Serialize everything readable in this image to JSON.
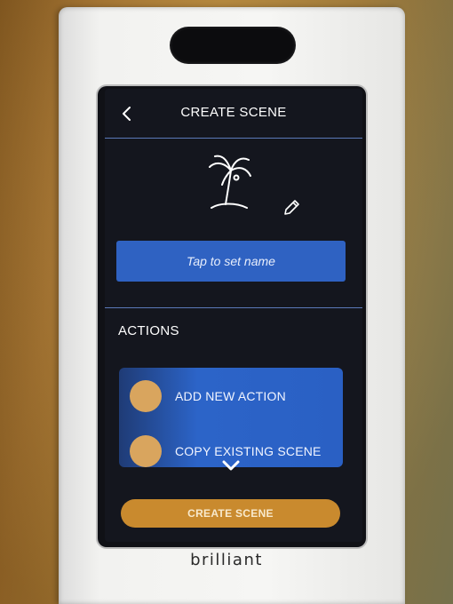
{
  "header": {
    "title": "CREATE SCENE",
    "back_icon": "chevron-left-icon"
  },
  "scene": {
    "icon": "palm-tree-icon",
    "edit_icon": "pencil-icon",
    "name_placeholder": "Tap to set name"
  },
  "actions": {
    "section_label": "ACTIONS",
    "items": [
      {
        "label": "ADD NEW ACTION",
        "icon": "circle"
      },
      {
        "label": "COPY EXISTING SCENE",
        "icon": "circle"
      }
    ],
    "more_icon": "chevron-down-icon"
  },
  "footer": {
    "create_label": "CREATE SCENE"
  },
  "device": {
    "brand": "brilliant"
  },
  "colors": {
    "accent_blue": "#2f62c2",
    "accent_gold": "#c98a2e",
    "screen_bg": "#14161e"
  }
}
